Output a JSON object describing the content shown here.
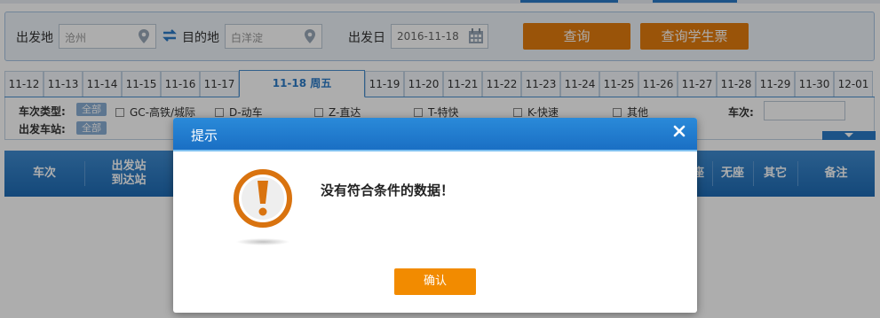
{
  "search": {
    "from_label": "出发地",
    "from_value": "沧州",
    "to_label": "目的地",
    "to_value": "白洋淀",
    "date_label": "出发日",
    "date_value": "2016-11-18",
    "query_button": "查询",
    "student_button": "查询学生票"
  },
  "dates": [
    "11-12",
    "11-13",
    "11-14",
    "11-15",
    "11-16",
    "11-17",
    "11-18 周五",
    "11-19",
    "11-20",
    "11-21",
    "11-22",
    "11-23",
    "11-24",
    "11-25",
    "11-26",
    "11-27",
    "11-28",
    "11-29",
    "11-30",
    "12-01"
  ],
  "filter": {
    "type_label": "车次类型:",
    "all_label": "全部",
    "options": [
      "GC-高铁/城际",
      "D-动车",
      "Z-直达",
      "T-特快",
      "K-快速",
      "其他"
    ],
    "train_no_label": "车次:",
    "station_label": "出发车站:",
    "station_all": "全部"
  },
  "table_headers": {
    "train": "车次",
    "stations_top": "出发站",
    "stations_bottom": "到达站",
    "standing_tail": "座",
    "no_seat": "无座",
    "other": "其它",
    "remark": "备注"
  },
  "dialog": {
    "title": "提示",
    "message": "没有符合条件的数据！",
    "confirm": "确认"
  },
  "colors": {
    "primary_blue": "#2b7bc8",
    "orange": "#e37c0e",
    "confirm_orange": "#f28b00"
  }
}
